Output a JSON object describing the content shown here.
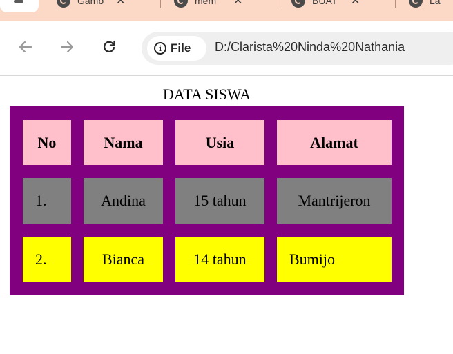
{
  "browser": {
    "tabs": [
      {
        "title": "Gamb",
        "close": "✕"
      },
      {
        "title": "mem",
        "close": "✕"
      },
      {
        "title": "BUAT",
        "close": "✕"
      },
      {
        "title": "La",
        "close": ""
      }
    ],
    "address": {
      "chip_label": "File",
      "url": "D:/Clarista%20Ninda%20Nathania"
    },
    "icons": [
      "back-arrow-icon",
      "forward-arrow-icon",
      "reload-icon",
      "info-icon",
      "tab-favicon"
    ]
  },
  "page": {
    "caption": "DATA SISWA",
    "table": {
      "headers": [
        "No",
        "Nama",
        "Usia",
        "Alamat"
      ],
      "rows": [
        [
          "1.",
          "Andina",
          "15 tahun",
          "Mantrijeron"
        ],
        [
          "2.",
          "Bianca",
          "14 tahun",
          "Bumijo"
        ]
      ],
      "colors": {
        "table_background": "#800080",
        "header_background": "#ffc0cb",
        "row1_background": "#808080",
        "row2_background": "#ffff00"
      }
    }
  }
}
